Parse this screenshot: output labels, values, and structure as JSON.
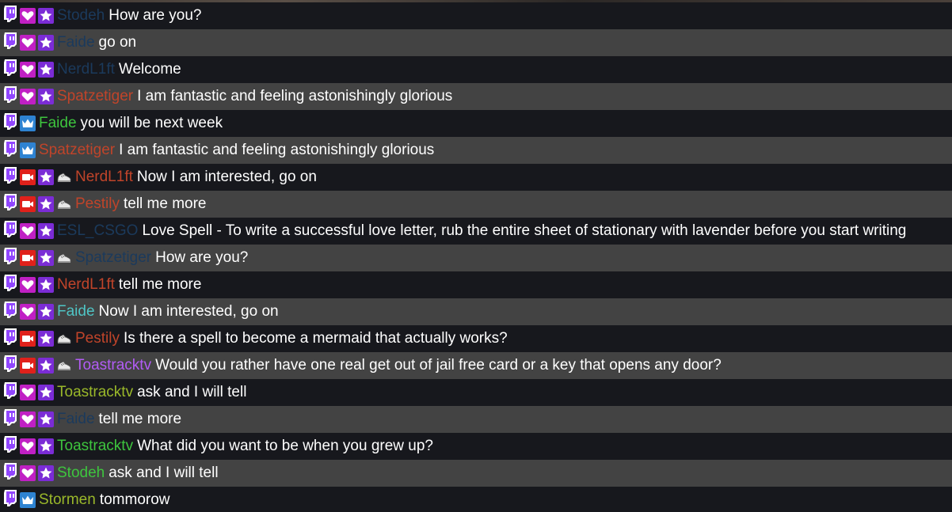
{
  "colors": {
    "dark_row": "#17181d",
    "light_row": "#434343",
    "text": "#ffffff",
    "twitch_purple": "#9146ff",
    "sub_magenta": "#c020c4",
    "star_purple": "#7b2cd6",
    "crown_blue": "#2e83d2",
    "cam_red": "#e0211b"
  },
  "messages": [
    {
      "user": "Stodeh",
      "user_color": "#1b3a5c",
      "text": "How are you?",
      "badges": [
        "twitch-icon",
        "heart-icon",
        "star-icon"
      ]
    },
    {
      "user": "Faide",
      "user_color": "#1b3a5c",
      "text": "go on",
      "badges": [
        "twitch-icon",
        "heart-icon",
        "star-icon"
      ]
    },
    {
      "user": "NerdL1ft",
      "user_color": "#1b3a5c",
      "text": "Welcome",
      "badges": [
        "twitch-icon",
        "heart-icon",
        "star-icon"
      ]
    },
    {
      "user": "Spatzetiger",
      "user_color": "#c0442a",
      "text": "I am fantastic and feeling astonishingly glorious",
      "badges": [
        "twitch-icon",
        "heart-icon",
        "star-icon"
      ]
    },
    {
      "user": "Faide",
      "user_color": "#3ec53e",
      "text": "you will be next week",
      "badges": [
        "twitch-icon",
        "crown-icon"
      ]
    },
    {
      "user": "Spatzetiger",
      "user_color": "#c0442a",
      "text": "I am fantastic and feeling astonishingly glorious",
      "badges": [
        "twitch-icon",
        "crown-icon"
      ]
    },
    {
      "user": "NerdL1ft",
      "user_color": "#c0442a",
      "text": "Now I am interested, go on",
      "badges": [
        "twitch-icon",
        "camera-icon",
        "star-icon",
        "sneaker-icon"
      ]
    },
    {
      "user": "Pestily",
      "user_color": "#c0442a",
      "text": "tell me more",
      "badges": [
        "twitch-icon",
        "camera-icon",
        "star-icon",
        "sneaker-icon"
      ]
    },
    {
      "user": "ESL_CSGO",
      "user_color": "#1b3a5c",
      "text": "Love Spell - To write a successful love letter, rub the entire sheet of stationary with lavender before you start writing",
      "badges": [
        "twitch-icon",
        "heart-icon",
        "star-icon"
      ]
    },
    {
      "user": "Spatzetiger",
      "user_color": "#1b3a5c",
      "text": "How are you?",
      "badges": [
        "twitch-icon",
        "camera-icon",
        "star-icon",
        "sneaker-icon"
      ]
    },
    {
      "user": "NerdL1ft",
      "user_color": "#c0442a",
      "text": "tell me more",
      "badges": [
        "twitch-icon",
        "heart-icon",
        "star-icon"
      ]
    },
    {
      "user": "Faide",
      "user_color": "#4fc5c5",
      "text": "Now I am interested, go on",
      "badges": [
        "twitch-icon",
        "heart-icon",
        "star-icon"
      ]
    },
    {
      "user": "Pestily",
      "user_color": "#c0442a",
      "text": "Is there a spell to become a mermaid that actually works?",
      "badges": [
        "twitch-icon",
        "camera-icon",
        "star-icon",
        "sneaker-icon"
      ]
    },
    {
      "user": "Toastracktv",
      "user_color": "#b25cf5",
      "text": "Would you rather have one real get out of jail free card or a key that opens any door?",
      "badges": [
        "twitch-icon",
        "camera-icon",
        "star-icon",
        "sneaker-icon"
      ]
    },
    {
      "user": "Toastracktv",
      "user_color": "#9ab82a",
      "text": "ask and I will tell",
      "badges": [
        "twitch-icon",
        "heart-icon",
        "star-icon"
      ]
    },
    {
      "user": "Faide",
      "user_color": "#1b3a5c",
      "text": "tell me more",
      "badges": [
        "twitch-icon",
        "heart-icon",
        "star-icon"
      ]
    },
    {
      "user": "Toastracktv",
      "user_color": "#3ec53e",
      "text": "What did you want to be when you grew up?",
      "badges": [
        "twitch-icon",
        "heart-icon",
        "star-icon"
      ]
    },
    {
      "user": "Stodeh",
      "user_color": "#3ec53e",
      "text": "ask and I will tell",
      "badges": [
        "twitch-icon",
        "heart-icon",
        "star-icon"
      ]
    },
    {
      "user": "Stormen",
      "user_color": "#9ab82a",
      "text": "tommorow",
      "badges": [
        "twitch-icon",
        "crown-icon"
      ]
    }
  ]
}
